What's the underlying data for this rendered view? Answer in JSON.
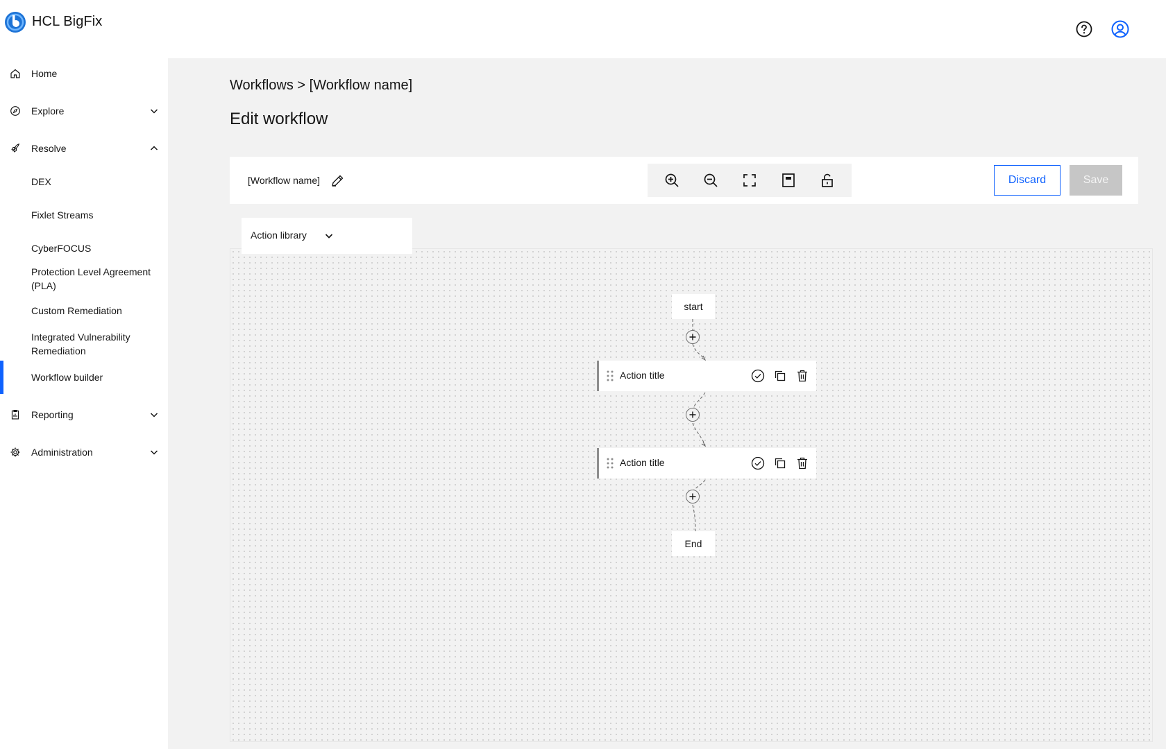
{
  "app": {
    "brand": "HCL BigFix"
  },
  "header": {
    "help_icon": "help-icon",
    "user_icon": "user-avatar-icon"
  },
  "sidebar": {
    "items": [
      {
        "label": "Home",
        "icon": "home-icon"
      },
      {
        "label": "Explore",
        "icon": "compass-icon",
        "expanded": false
      },
      {
        "label": "Resolve",
        "icon": "rocket-icon",
        "expanded": true
      },
      {
        "label": "Reporting",
        "icon": "report-icon",
        "expanded": false
      },
      {
        "label": "Administration",
        "icon": "gear-icon",
        "expanded": false
      }
    ],
    "resolve_children": [
      "DEX",
      "Fixlet Streams",
      "CyberFOCUS",
      "Protection Level Agreement (PLA)",
      "Custom Remediation",
      "Integrated Vulnerability Remediation",
      "Workflow builder"
    ],
    "active_item": "Workflow builder",
    "accent_color": "#0f62fe"
  },
  "main": {
    "breadcrumb": "Workflows > [Workflow name]",
    "title": "Edit workflow",
    "toolbar": {
      "workflow_name": "[Workflow name]",
      "tools": [
        "zoom-in-icon",
        "zoom-out-icon",
        "fit-to-screen-icon",
        "minimap-icon",
        "unlock-icon"
      ],
      "discard_label": "Discard",
      "save_label": "Save"
    },
    "action_library": {
      "label": "Action library"
    },
    "flow": {
      "start_label": "start",
      "end_label": "End",
      "actions": [
        {
          "title": "Action title"
        },
        {
          "title": "Action title"
        }
      ]
    }
  }
}
